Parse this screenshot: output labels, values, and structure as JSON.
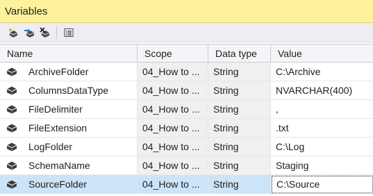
{
  "window": {
    "title": "Variables"
  },
  "toolbar": {
    "buttons": [
      {
        "name": "add-variable-button",
        "icon": "add-variable-icon"
      },
      {
        "name": "move-variable-button",
        "icon": "move-variable-icon"
      },
      {
        "name": "delete-variable-button",
        "icon": "delete-variable-icon"
      },
      {
        "name": "grid-options-button",
        "icon": "grid-options-icon"
      }
    ]
  },
  "grid": {
    "columns": [
      "Name",
      "Scope",
      "Data type",
      "Value"
    ],
    "rows": [
      {
        "name": "ArchiveFolder",
        "scope": "04_How to ...",
        "type": "String",
        "value": "C:\\Archive"
      },
      {
        "name": "ColumnsDataType",
        "scope": "04_How to ...",
        "type": "String",
        "value": "NVARCHAR(400)"
      },
      {
        "name": "FileDelimiter",
        "scope": "04_How to ...",
        "type": "String",
        "value": ","
      },
      {
        "name": "FileExtension",
        "scope": "04_How to ...",
        "type": "String",
        "value": ".txt"
      },
      {
        "name": "LogFolder",
        "scope": "04_How to ...",
        "type": "String",
        "value": "C:\\Log"
      },
      {
        "name": "SchemaName",
        "scope": "04_How to ...",
        "type": "String",
        "value": "Staging"
      },
      {
        "name": "SourceFolder",
        "scope": "04_How to ...",
        "type": "String",
        "value": "C:\\Source"
      }
    ],
    "selected_row": 6
  },
  "colors": {
    "titlebar": "#fff29d",
    "selection": "#cce4f7",
    "toolbar": "#eeeef2"
  }
}
